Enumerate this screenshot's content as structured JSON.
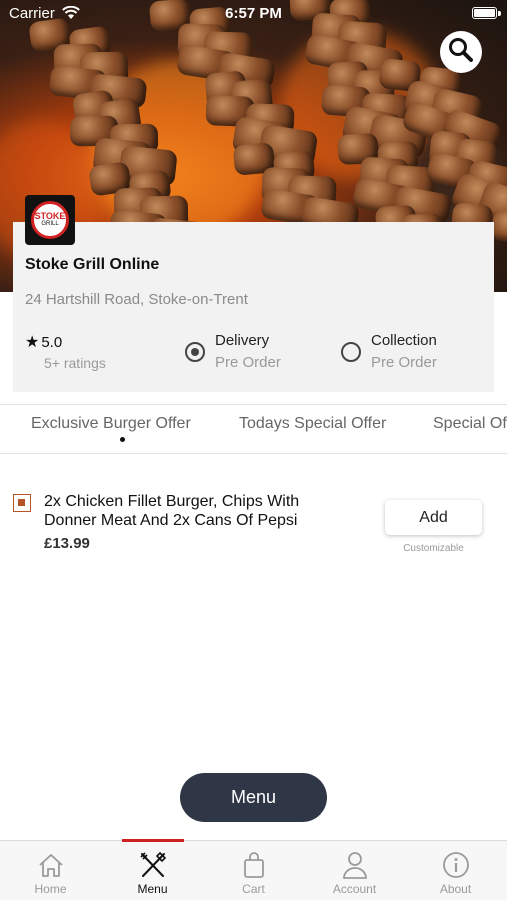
{
  "status_bar": {
    "carrier": "Carrier",
    "time": "6:57 PM"
  },
  "restaurant": {
    "name": "Stoke Grill Online",
    "address": "24 Hartshill Road, Stoke-on-Trent",
    "rating": "5.0",
    "ratings_count": "5+ ratings",
    "logo_text": "STOKE",
    "logo_subtext": "GRILL"
  },
  "order_options": [
    {
      "label": "Delivery",
      "sub": "Pre Order",
      "selected": true
    },
    {
      "label": "Collection",
      "sub": "Pre Order",
      "selected": false
    }
  ],
  "categories": [
    "Exclusive Burger Offer",
    "Todays Special Offer",
    "Special Offer"
  ],
  "items": [
    {
      "name": "2x Chicken Fillet Burger, Chips With Donner Meat And 2x Cans Of Pepsi",
      "price": "£13.99",
      "add_label": "Add",
      "note": "Customizable"
    }
  ],
  "menu_button": "Menu",
  "bottom_nav": [
    {
      "label": "Home",
      "icon": "home-icon"
    },
    {
      "label": "Menu",
      "icon": "utensils-icon",
      "active": true
    },
    {
      "label": "Cart",
      "icon": "shopping-bag-icon"
    },
    {
      "label": "Account",
      "icon": "user-icon"
    },
    {
      "label": "About",
      "icon": "info-icon"
    }
  ],
  "colors": {
    "accent": "#d12222",
    "fab": "#2f3747",
    "item_marker": "#b5532b"
  }
}
